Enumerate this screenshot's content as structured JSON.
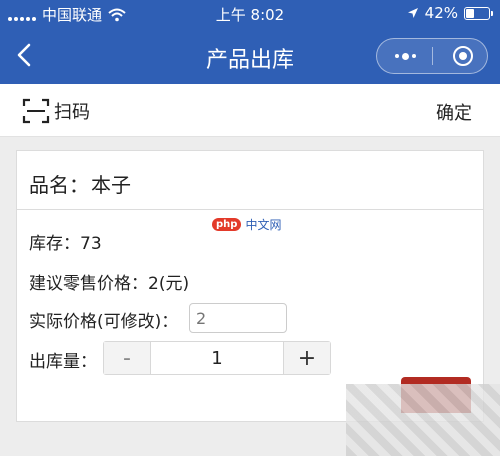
{
  "status_bar": {
    "carrier": "中国联通",
    "time": "上午 8:02",
    "battery": "42%",
    "battery_level": 0.42
  },
  "nav": {
    "title": "产品出库"
  },
  "toolbar": {
    "scan_label": "扫码",
    "confirm_label": "确定"
  },
  "product": {
    "name_label": "品名：",
    "name_value": "本子",
    "stock_label": "库存：",
    "stock_value": "73",
    "suggested_price_label": "建议零售价格：",
    "suggested_price_value": "2(元)",
    "actual_price_label": "实际价格(可修改)：",
    "actual_price_placeholder": "2",
    "quantity_label": "出库量：",
    "quantity_value": "1",
    "minus_label": "-",
    "plus_label": "+"
  },
  "watermark": {
    "php": "php",
    "text": "中文网"
  },
  "colors": {
    "brand": "#2f5fb5",
    "accent_red": "#b22b22"
  }
}
